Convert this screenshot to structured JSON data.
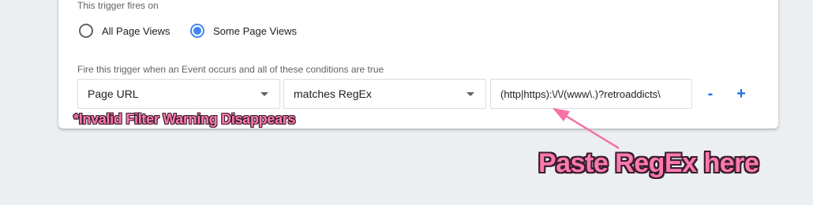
{
  "trigger": {
    "fires_on_label": "This trigger fires on",
    "options": [
      {
        "label": "All Page Views",
        "selected": false
      },
      {
        "label": "Some Page Views",
        "selected": true
      }
    ],
    "condition_label": "Fire this trigger when an Event occurs and all of these conditions are true",
    "condition": {
      "variable": "Page URL",
      "operator": "matches RegEx",
      "value": "(http|https):\\/\\/(www\\.)?retroaddicts\\"
    },
    "remove_label": "-",
    "add_label": "+"
  },
  "annotations": {
    "warning_note": "*Invalid Filter Warning Disappears",
    "paste_note": "Paste RegEx here"
  },
  "colors": {
    "accent": "#4285f4",
    "annotation_pink": "#ff79b0",
    "background": "#eceff1"
  },
  "icons": {
    "dropdown": "chevron-down-icon",
    "arrow": "pointer-arrow-icon"
  }
}
